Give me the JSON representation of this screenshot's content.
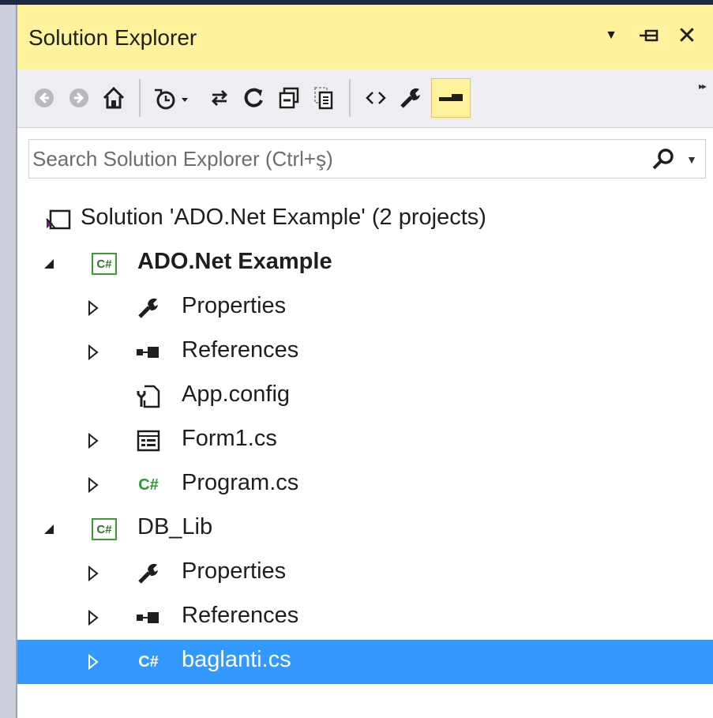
{
  "panel": {
    "title": "Solution Explorer",
    "controls": {
      "dropdown_glyph": "▼",
      "pin_glyph": "⊣",
      "close_glyph": "✕"
    }
  },
  "toolbar": {
    "buttons": [
      {
        "name": "back-icon"
      },
      {
        "name": "forward-icon"
      },
      {
        "name": "home-icon"
      },
      {
        "name": "pending-changes-filter-icon"
      },
      {
        "name": "sync-with-active-document-icon"
      },
      {
        "name": "refresh-icon"
      },
      {
        "name": "collapse-all-icon"
      },
      {
        "name": "show-all-files-icon"
      },
      {
        "name": "view-code-icon"
      },
      {
        "name": "properties-icon"
      },
      {
        "name": "preview-selected-items-icon"
      }
    ],
    "overflow_glyph": "▸▸"
  },
  "search": {
    "placeholder": "Search Solution Explorer (Ctrl+ş)"
  },
  "tree": {
    "solution": "Solution 'ADO.Net Example' (2 projects)",
    "project1": {
      "name": "ADO.Net Example",
      "icon_text": "C#",
      "items": {
        "properties": "Properties",
        "references": "References",
        "appconfig": "App.config",
        "form1": "Form1.cs",
        "program": "Program.cs"
      }
    },
    "project2": {
      "name": "DB_Lib",
      "icon_text": "C#",
      "items": {
        "properties": "Properties",
        "references": "References",
        "baglanti": "baglanti.cs"
      }
    },
    "file_icon_text": "C#"
  },
  "colors": {
    "title_bar": "#fff29d",
    "selection": "#3399ff",
    "csharp_green": "#2e9a2e"
  }
}
